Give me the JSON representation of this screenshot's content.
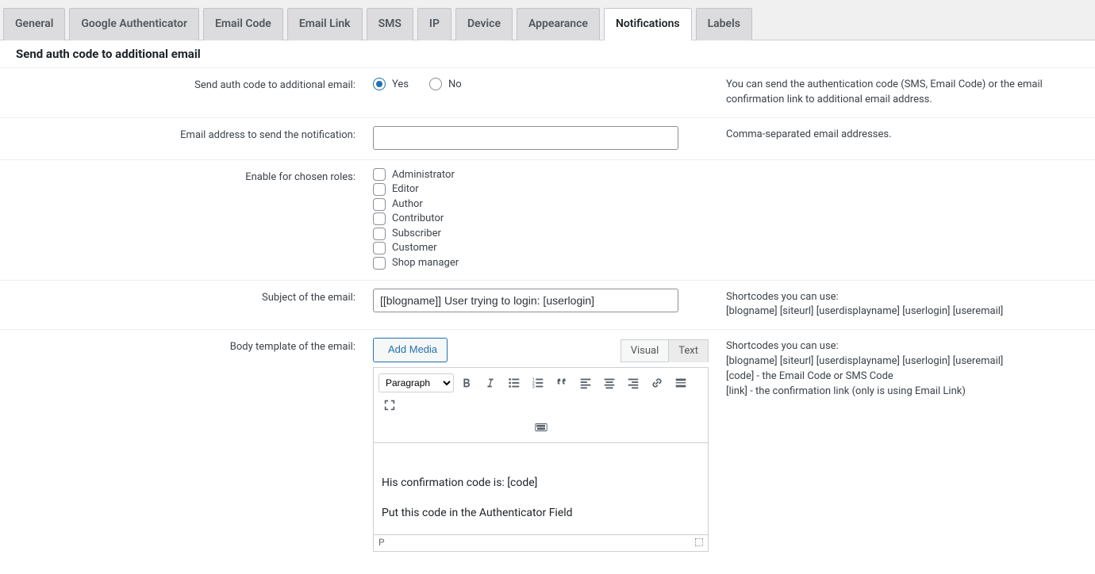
{
  "tabs": [
    {
      "label": "General"
    },
    {
      "label": "Google Authenticator"
    },
    {
      "label": "Email Code"
    },
    {
      "label": "Email Link"
    },
    {
      "label": "SMS"
    },
    {
      "label": "IP"
    },
    {
      "label": "Device"
    },
    {
      "label": "Appearance"
    },
    {
      "label": "Notifications",
      "active": true
    },
    {
      "label": "Labels"
    }
  ],
  "section_title": "Send auth code to additional email",
  "rows": {
    "send_code": {
      "label": "Send auth code to additional email:",
      "options": {
        "yes": "Yes",
        "no": "No"
      },
      "value": "yes",
      "desc": "You can send the authentication code (SMS, Email Code) or the email confirmation link to additional email address."
    },
    "email_address": {
      "label": "Email address to send the notification:",
      "value": "",
      "desc": "Comma-separated email addresses."
    },
    "roles": {
      "label": "Enable for chosen roles:",
      "items": [
        "Administrator",
        "Editor",
        "Author",
        "Contributor",
        "Subscriber",
        "Customer",
        "Shop manager"
      ]
    },
    "subject": {
      "label": "Subject of the email:",
      "value": "[[blogname]] User trying to login: [userlogin]",
      "desc_line1": "Shortcodes you can use:",
      "desc_line2": "[blogname] [siteurl] [userdisplayname] [userlogin] [useremail]"
    },
    "body": {
      "label": "Body template of the email:",
      "add_media": "Add Media",
      "tabs": {
        "visual": "Visual",
        "text": "Text"
      },
      "format": "Paragraph",
      "content_line1": "His confirmation code is: [code]",
      "content_line2": "Put this code in the Authenticator Field",
      "status_path": "P",
      "desc_line1": "Shortcodes you can use:",
      "desc_line2": "[blogname] [siteurl] [userdisplayname] [userlogin] [useremail]",
      "desc_line3": "[code] - the Email Code or SMS Code",
      "desc_line4": "[link] - the confirmation link (only is using Email Link)"
    }
  }
}
